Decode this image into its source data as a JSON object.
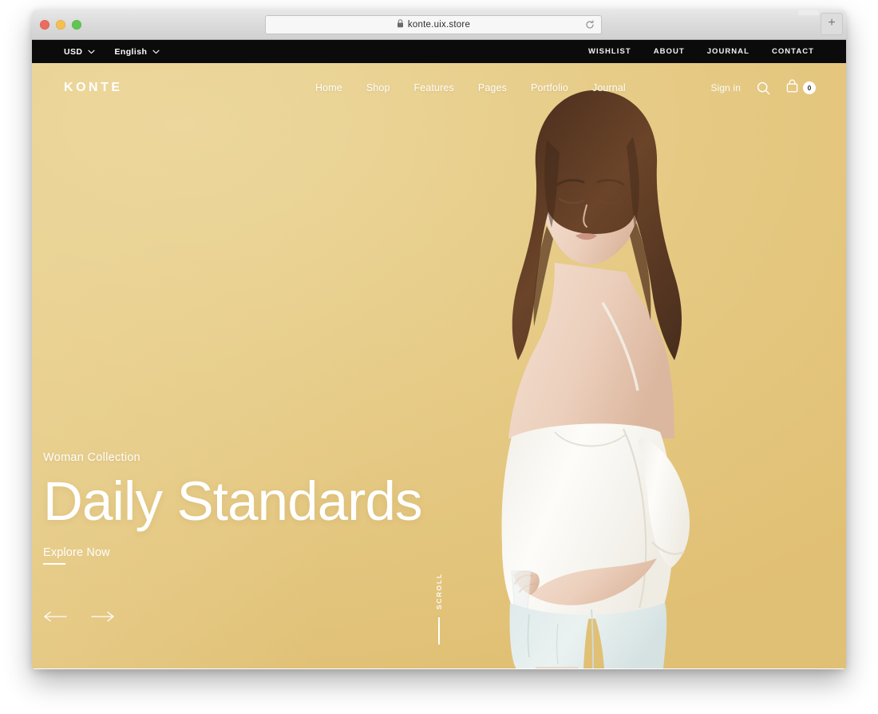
{
  "browser": {
    "url": "konte.uix.store",
    "lock_icon": "lock-icon",
    "reload_icon": "reload-icon",
    "newtab_label": "+",
    "traffic_lights": [
      "close-red",
      "minimize-yellow",
      "zoom-green"
    ]
  },
  "topbar": {
    "currency": {
      "label": "USD",
      "chevron": "chevron-down-icon"
    },
    "language": {
      "label": "English",
      "chevron": "chevron-down-icon"
    },
    "links": [
      "WISHLIST",
      "ABOUT",
      "JOURNAL",
      "CONTACT"
    ]
  },
  "header": {
    "logo": "KONTE",
    "nav": [
      "Home",
      "Shop",
      "Features",
      "Pages",
      "Portfolio",
      "Journal"
    ],
    "signin": "Sign in",
    "search_icon": "search-icon",
    "cart_icon": "shopping-bag-icon",
    "cart_count": "0"
  },
  "hero": {
    "eyebrow": "Woman Collection",
    "headline": "Daily Standards",
    "cta": "Explore Now",
    "prev_icon": "arrow-left-icon",
    "next_icon": "arrow-right-icon",
    "scroll_label": "SCROLL"
  },
  "colors": {
    "hero_gradient_light": "#ecd79c",
    "hero_gradient_mid": "#e7cd8a",
    "hero_gradient_dark": "#e0c075",
    "topbar_bg": "#0b0b0b",
    "text_on_hero": "#ffffff",
    "page_bg": "#ffffff",
    "traffic_red": "#ed6a5e",
    "traffic_yellow": "#f5bf4f",
    "traffic_green": "#61c554",
    "garment_top": "#fbfaf7",
    "garment_shorts": "#e2ecec",
    "hair": "#5a3a26"
  }
}
